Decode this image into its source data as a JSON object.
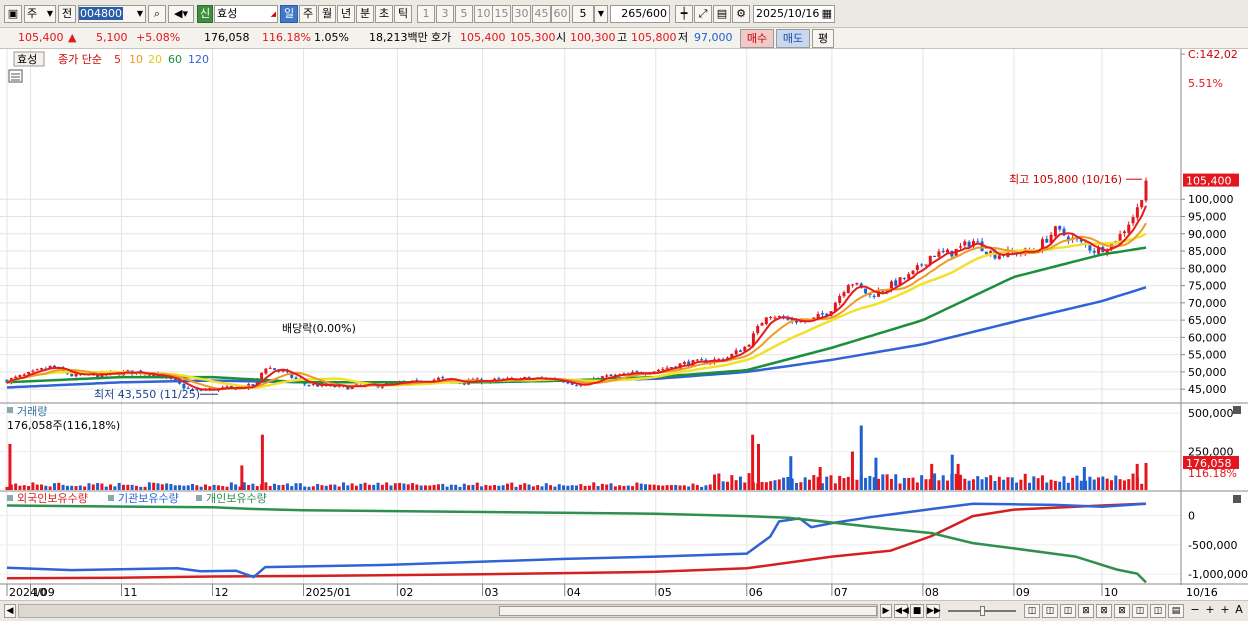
{
  "toolbar": {
    "market": "주",
    "prev_label": "전",
    "code": "004800",
    "badge": "신",
    "name": "효성",
    "periods": [
      "일",
      "주",
      "월",
      "년",
      "분",
      "초",
      "틱"
    ],
    "intervals": [
      "1",
      "3",
      "5",
      "10",
      "15",
      "30",
      "45",
      "60"
    ],
    "interval_value": "5",
    "count": "265",
    "count_total": "/600",
    "date": "2025/10/16"
  },
  "quote": {
    "price": "105,400",
    "arrow": "▲",
    "change": "5,100",
    "change_pct": "+5.08%",
    "volume": "176,058",
    "volume_ratio": "116.18%",
    "turnover_pct": "1.05%",
    "amount": "18,213백만",
    "hoga_label": "호가",
    "ask": "105,400",
    "bid": "105,300",
    "open_label": "시",
    "open": "100,300",
    "high_label": "고",
    "high": "105,800",
    "low_label": "저",
    "low": "97,000",
    "buy_button": "매수",
    "sell_button": "매도",
    "eval_button": "평"
  },
  "colors": {
    "up": "#e3161f",
    "down": "#1f5fce",
    "ma5": "#e41c1c",
    "ma10": "#ef9a22",
    "ma20": "#f2e12a",
    "ma60": "#1b8f3a",
    "ma120": "#2f63d6",
    "foreign": "#d42020",
    "institution": "#2f63d6",
    "individual": "#2f8f4f"
  },
  "chart_data": [
    {
      "type": "candlestick",
      "legend": {
        "stock": "효성",
        "prefix": "종가 단순",
        "items": [
          "5",
          "10",
          "20",
          "60",
          "120"
        ]
      },
      "ylim": [
        41000,
        143500
      ],
      "y_ticks": [
        "142,02",
        "100,000",
        "95,000",
        "90,000",
        "85,000",
        "80,000",
        "75,000",
        "70,000",
        "65,000",
        "60,000",
        "55,000",
        "50,000",
        "45,000"
      ],
      "y_tick_values": [
        142020,
        100000,
        95000,
        90000,
        85000,
        80000,
        75000,
        70000,
        65000,
        60000,
        55000,
        50000,
        45000
      ],
      "price_tag": "105,400",
      "price_tag_value": 105400,
      "pct_tag": "5.51%",
      "max_annotation": "최고 105,800 (10/16)",
      "max_value": 105800,
      "min_annotation": "최저 43,550 (11/25)",
      "min_value": 43550,
      "dividend_annotation": "배당락(0.00%)",
      "x_ticks": [
        "2024/09",
        "10",
        "11",
        "12",
        "2025/01",
        "02",
        "03",
        "04",
        "05",
        "06",
        "07",
        "08",
        "09",
        "10",
        "10/16"
      ],
      "x_tick_dates": [
        "2024-09-23",
        "2024-10-01",
        "2024-11-01",
        "2024-12-02",
        "2025-01-02",
        "2025-02-03",
        "2025-03-04",
        "2025-04-01",
        "2025-05-02",
        "2025-06-02",
        "2025-07-01",
        "2025-08-01",
        "2025-09-01",
        "2025-10-01"
      ],
      "last_date": "2025-10-16",
      "close_series": [
        [
          "2024-09-23",
          47500
        ],
        [
          "2024-10-01",
          49500
        ],
        [
          "2024-10-08",
          51500
        ],
        [
          "2024-10-15",
          49000
        ],
        [
          "2024-10-22",
          49000
        ],
        [
          "2024-10-29",
          49500
        ],
        [
          "2024-11-05",
          50000
        ],
        [
          "2024-11-12",
          49500
        ],
        [
          "2024-11-19",
          47000
        ],
        [
          "2024-11-25",
          44500
        ],
        [
          "2024-12-02",
          45000
        ],
        [
          "2024-12-09",
          45200
        ],
        [
          "2024-12-16",
          46000
        ],
        [
          "2024-12-20",
          51500
        ],
        [
          "2024-12-26",
          50000
        ],
        [
          "2025-01-02",
          46500
        ],
        [
          "2025-01-09",
          46000
        ],
        [
          "2025-01-16",
          45500
        ],
        [
          "2025-01-23",
          46000
        ],
        [
          "2025-02-03",
          46500
        ],
        [
          "2025-02-10",
          47000
        ],
        [
          "2025-02-17",
          48000
        ],
        [
          "2025-02-24",
          47000
        ],
        [
          "2025-03-04",
          47500
        ],
        [
          "2025-03-11",
          47500
        ],
        [
          "2025-03-18",
          48000
        ],
        [
          "2025-03-25",
          48000
        ],
        [
          "2025-04-01",
          47500
        ],
        [
          "2025-04-07",
          46000
        ],
        [
          "2025-04-14",
          48500
        ],
        [
          "2025-04-21",
          49000
        ],
        [
          "2025-05-02",
          50500
        ],
        [
          "2025-05-12",
          52500
        ],
        [
          "2025-05-19",
          53000
        ],
        [
          "2025-05-26",
          54000
        ],
        [
          "2025-06-02",
          57500
        ],
        [
          "2025-06-09",
          67000
        ],
        [
          "2025-06-16",
          65000
        ],
        [
          "2025-06-23",
          64500
        ],
        [
          "2025-06-30",
          67500
        ],
        [
          "2025-07-07",
          76500
        ],
        [
          "2025-07-14",
          72000
        ],
        [
          "2025-07-21",
          75000
        ],
        [
          "2025-07-28",
          78000
        ],
        [
          "2025-08-04",
          84000
        ],
        [
          "2025-08-11",
          84500
        ],
        [
          "2025-08-18",
          88000
        ],
        [
          "2025-08-25",
          84000
        ],
        [
          "2025-09-01",
          84500
        ],
        [
          "2025-09-08",
          85000
        ],
        [
          "2025-09-15",
          91000
        ],
        [
          "2025-09-22",
          88000
        ],
        [
          "2025-09-29",
          85000
        ],
        [
          "2025-10-06",
          88000
        ],
        [
          "2025-10-13",
          97000
        ],
        [
          "2025-10-16",
          105400
        ]
      ],
      "ma60_series": [
        [
          "2024-09-23",
          47000
        ],
        [
          "2024-11-01",
          48500
        ],
        [
          "2024-12-02",
          48500
        ],
        [
          "2025-01-02",
          47000
        ],
        [
          "2025-03-04",
          47000
        ],
        [
          "2025-04-01",
          47500
        ],
        [
          "2025-05-02",
          48500
        ],
        [
          "2025-06-02",
          50500
        ],
        [
          "2025-07-01",
          57000
        ],
        [
          "2025-08-01",
          65000
        ],
        [
          "2025-09-01",
          77500
        ],
        [
          "2025-10-01",
          84000
        ],
        [
          "2025-10-16",
          86000
        ]
      ],
      "ma120_series": [
        [
          "2024-09-23",
          45500
        ],
        [
          "2024-11-01",
          47000
        ],
        [
          "2024-12-02",
          47500
        ],
        [
          "2025-01-02",
          47000
        ],
        [
          "2025-03-04",
          47000
        ],
        [
          "2025-05-02",
          48000
        ],
        [
          "2025-06-02",
          50000
        ],
        [
          "2025-07-01",
          53500
        ],
        [
          "2025-08-01",
          58000
        ],
        [
          "2025-09-01",
          64500
        ],
        [
          "2025-10-01",
          70500
        ],
        [
          "2025-10-16",
          74500
        ]
      ]
    },
    {
      "type": "bar",
      "label": "거래량",
      "current_label": "176,058주(116,18%)",
      "ylim": [
        0,
        560000
      ],
      "y_ticks": [
        "500,000",
        "250,000"
      ],
      "y_tick_values": [
        500000,
        250000
      ],
      "tag": "176,058",
      "tag_value": 176058,
      "tag_pct": "116.18%",
      "spikes": [
        [
          "2024-09-24",
          300000
        ],
        [
          "2024-12-12",
          160000
        ],
        [
          "2024-12-19",
          360000
        ],
        [
          "2025-06-04",
          360000
        ],
        [
          "2025-06-06",
          300000
        ],
        [
          "2025-06-17",
          220000
        ],
        [
          "2025-06-27",
          150000
        ],
        [
          "2025-07-08",
          250000
        ],
        [
          "2025-07-11",
          420000
        ],
        [
          "2025-07-16",
          210000
        ],
        [
          "2025-08-04",
          170000
        ],
        [
          "2025-08-11",
          230000
        ],
        [
          "2025-08-13",
          170000
        ],
        [
          "2025-09-25",
          150000
        ],
        [
          "2025-10-13",
          170000
        ],
        [
          "2025-10-16",
          176058
        ]
      ]
    },
    {
      "type": "line",
      "legend": [
        "외국인보유수량",
        "기관보유수량",
        "개인보유수량"
      ],
      "ylim": [
        -1150000,
        400000
      ],
      "y_ticks": [
        "0",
        "-500,000",
        "-1,000,000"
      ],
      "y_tick_values": [
        0,
        -500000,
        -1000000
      ],
      "series": [
        {
          "name": "외국인보유수량",
          "points": [
            [
              "2024-09-23",
              -1070000
            ],
            [
              "2024-11-01",
              -1060000
            ],
            [
              "2024-12-02",
              -1040000
            ],
            [
              "2025-01-02",
              -1030000
            ],
            [
              "2025-03-04",
              -1000000
            ],
            [
              "2025-05-02",
              -960000
            ],
            [
              "2025-06-02",
              -900000
            ],
            [
              "2025-07-01",
              -700000
            ],
            [
              "2025-07-21",
              -600000
            ],
            [
              "2025-08-04",
              -350000
            ],
            [
              "2025-08-18",
              -10000
            ],
            [
              "2025-09-01",
              100000
            ],
            [
              "2025-10-01",
              170000
            ],
            [
              "2025-10-16",
              200000
            ]
          ]
        },
        {
          "name": "기관보유수량",
          "points": [
            [
              "2024-09-23",
              -890000
            ],
            [
              "2024-10-15",
              -930000
            ],
            [
              "2024-11-20",
              -900000
            ],
            [
              "2024-11-28",
              -950000
            ],
            [
              "2024-12-10",
              -940000
            ],
            [
              "2024-12-16",
              -1050000
            ],
            [
              "2024-12-20",
              -880000
            ],
            [
              "2025-02-01",
              -840000
            ],
            [
              "2025-04-01",
              -740000
            ],
            [
              "2025-05-02",
              -700000
            ],
            [
              "2025-06-02",
              -650000
            ],
            [
              "2025-06-10",
              -360000
            ],
            [
              "2025-06-13",
              -100000
            ],
            [
              "2025-06-20",
              -50000
            ],
            [
              "2025-06-24",
              -200000
            ],
            [
              "2025-07-01",
              -130000
            ],
            [
              "2025-07-14",
              -30000
            ],
            [
              "2025-08-04",
              110000
            ],
            [
              "2025-08-18",
              200000
            ],
            [
              "2025-09-01",
              190000
            ],
            [
              "2025-09-15",
              180000
            ],
            [
              "2025-10-01",
              150000
            ],
            [
              "2025-10-16",
              200000
            ]
          ]
        },
        {
          "name": "개인보유수량",
          "points": [
            [
              "2024-09-23",
              170000
            ],
            [
              "2024-10-15",
              160000
            ],
            [
              "2024-12-02",
              140000
            ],
            [
              "2024-12-16",
              110000
            ],
            [
              "2025-01-02",
              90000
            ],
            [
              "2025-03-04",
              60000
            ],
            [
              "2025-05-02",
              30000
            ],
            [
              "2025-06-02",
              -10000
            ],
            [
              "2025-06-16",
              -40000
            ],
            [
              "2025-07-01",
              -120000
            ],
            [
              "2025-07-21",
              -230000
            ],
            [
              "2025-08-04",
              -300000
            ],
            [
              "2025-08-18",
              -470000
            ],
            [
              "2025-09-01",
              -560000
            ],
            [
              "2025-09-22",
              -700000
            ],
            [
              "2025-10-06",
              -920000
            ],
            [
              "2025-10-13",
              -990000
            ],
            [
              "2025-10-16",
              -1140000
            ]
          ]
        }
      ]
    }
  ]
}
